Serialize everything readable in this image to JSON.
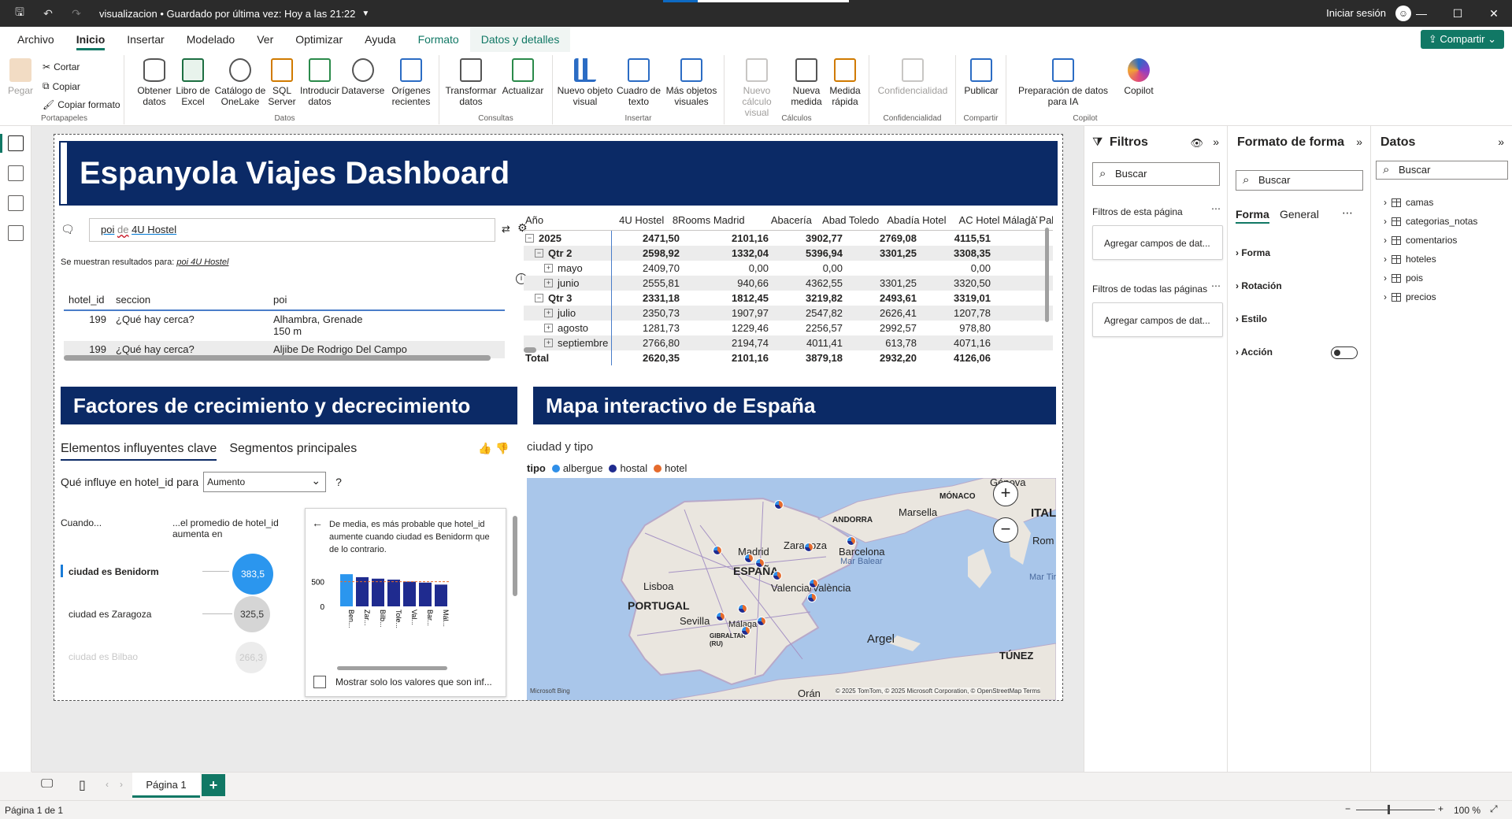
{
  "titlebar": {
    "doc_title": "visualizacion • Guardado por última vez: Hoy a las 21:22",
    "signin": "Iniciar sesión"
  },
  "tabs": [
    "Archivo",
    "Inicio",
    "Insertar",
    "Modelado",
    "Ver",
    "Optimizar",
    "Ayuda",
    "Formato",
    "Datos y detalles"
  ],
  "share_label": "Compartir",
  "ribbon": {
    "clipboard": {
      "paste": "Pegar",
      "cut": "Cortar",
      "copy": "Copiar",
      "format_painter": "Copiar formato",
      "group": "Portapapeles"
    },
    "data": {
      "get_data": "Obtener datos",
      "excel": "Libro de Excel",
      "onelake": "Catálogo de OneLake",
      "sql": "SQL Server",
      "enter": "Introducir datos",
      "dataverse": "Dataverse",
      "recent": "Orígenes recientes",
      "group": "Datos"
    },
    "queries": {
      "transform": "Transformar datos",
      "refresh": "Actualizar",
      "group": "Consultas"
    },
    "insert": {
      "new_visual": "Nuevo objeto visual",
      "textbox": "Cuadro de texto",
      "more_visuals": "Más objetos visuales",
      "group": "Insertar"
    },
    "calc": {
      "new_calc": "Nuevo cálculo visual",
      "new_measure": "Nueva medida",
      "quick_measure": "Medida rápida",
      "group": "Cálculos"
    },
    "conf": {
      "sensitivity": "Confidencialidad",
      "group": "Confidencialidad"
    },
    "share": {
      "publish": "Publicar",
      "group": "Compartir"
    },
    "copilot": {
      "prep": "Preparación de datos para IA",
      "copilot": "Copilot",
      "group": "Copilot"
    }
  },
  "dashboard": {
    "title": "Espanyola Viajes Dashboard",
    "qna": {
      "query_a": "poi",
      "query_b": "de",
      "query_c": "4U Hostel",
      "result_prefix": "Se muestran resultados para:",
      "result_value": "poi 4U Hostel",
      "columns": [
        "hotel_id",
        "seccion",
        "poi"
      ],
      "rows": [
        {
          "id": "199",
          "seccion": "¿Qué hay cerca?",
          "poi": "Alhambra, Grenade",
          "poi2": "150 m"
        },
        {
          "id": "199",
          "seccion": "¿Qué hay cerca?",
          "poi": "Aljibe De Rodrigo Del Campo",
          "poi2": ""
        }
      ]
    },
    "matrix": {
      "header": [
        "Año",
        "4U Hostel",
        "8Rooms Madrid",
        "Abacería",
        "Abad Toledo",
        "Abadía Hotel",
        "AC Hotel Málaga Pala"
      ],
      "rows": [
        {
          "label": "2025",
          "level": 0,
          "bold": true,
          "vals": [
            "2471,50",
            "2101,16",
            "3902,77",
            "2769,08",
            "4115,51"
          ]
        },
        {
          "label": "Qtr 2",
          "level": 1,
          "bold": true,
          "vals": [
            "2598,92",
            "1332,04",
            "5396,94",
            "3301,25",
            "3308,35"
          ]
        },
        {
          "label": "mayo",
          "level": 2,
          "bold": false,
          "vals": [
            "2409,70",
            "0,00",
            "0,00",
            "",
            "0,00"
          ]
        },
        {
          "label": "junio",
          "level": 2,
          "bold": false,
          "vals": [
            "2555,81",
            "940,66",
            "4362,55",
            "3301,25",
            "3320,50"
          ]
        },
        {
          "label": "Qtr 3",
          "level": 1,
          "bold": true,
          "vals": [
            "2331,18",
            "1812,45",
            "3219,82",
            "2493,61",
            "3319,01"
          ]
        },
        {
          "label": "julio",
          "level": 2,
          "bold": false,
          "vals": [
            "2350,73",
            "1907,97",
            "2547,82",
            "2626,41",
            "1207,78"
          ]
        },
        {
          "label": "agosto",
          "level": 2,
          "bold": false,
          "vals": [
            "1281,73",
            "1229,46",
            "2256,57",
            "2992,57",
            "978,80"
          ]
        },
        {
          "label": "septiembre",
          "level": 2,
          "bold": false,
          "vals": [
            "2766,80",
            "2194,74",
            "4011,41",
            "613,78",
            "4071,16"
          ]
        },
        {
          "label": "Total",
          "level": 0,
          "bold": true,
          "vals": [
            "2620,35",
            "2101,16",
            "3879,18",
            "2932,20",
            "4126,06"
          ]
        }
      ]
    },
    "growth_title": "Factores de crecimiento y decrecimiento",
    "map_title": "Mapa interactivo de España",
    "ki": {
      "tab1": "Elementos influyentes clave",
      "tab2": "Segmentos principales",
      "question": "Qué influye en hotel_id para",
      "select": "Aumento",
      "help": "?",
      "col_when": "Cuando...",
      "col_avg": "...el promedio de hotel_id aumenta en",
      "items": [
        {
          "label": "ciudad es Benidorm",
          "value": "383,5"
        },
        {
          "label": "ciudad es Zaragoza",
          "value": "325,5"
        },
        {
          "label": "ciudad es Bilbao",
          "value": "266,3"
        }
      ],
      "card_text": "De media, es más probable que hotel_id aumente cuando ciudad es Benidorm que de lo contrario.",
      "card_checkbox": "Mostrar solo los valores que son inf...",
      "chart_ticks": [
        "500",
        "0"
      ]
    },
    "map": {
      "subtitle": "ciudad y tipo",
      "legend_title": "tipo",
      "legend": [
        {
          "name": "albergue",
          "color": "#2f8fe8"
        },
        {
          "name": "hostal",
          "color": "#1f2b8f"
        },
        {
          "name": "hotel",
          "color": "#e56b2d"
        }
      ],
      "labels": {
        "madrid": "Madrid",
        "espana": "ESPAÑA",
        "zaragoza": "Zaragoza",
        "barcelona": "Barcelona",
        "marsella": "Marsella",
        "andorra": "ANDORRA",
        "monaco": "MÓNACO",
        "genova": "Génova",
        "lisboa": "Lisboa",
        "portugal": "PORTUGAL",
        "valencia": "Valencia/València",
        "sevilla": "Sevilla",
        "malaga": "Málaga",
        "gibraltar": "GIBRALTAR (RU)",
        "argel": "Argel",
        "oran": "Orán",
        "italia": "ITALI",
        "roma": "Rom",
        "balear": "Mar Balear",
        "tirreno": "Mar Tirr",
        "tunez": "TÚNEZ"
      },
      "attribution": "© 2025 TomTom, © 2025 Microsoft Corporation, © OpenStreetMap Terms",
      "bing": "Microsoft Bing"
    }
  },
  "chart_data": {
    "type": "bar",
    "categories": [
      "Ben...",
      "Zar...",
      "Bilb...",
      "Tole...",
      "Val...",
      "Bar...",
      "Mál..."
    ],
    "values": [
      650,
      590,
      560,
      540,
      500,
      480,
      440
    ],
    "ylim": [
      0,
      700
    ],
    "ytick_labels": [
      "500",
      "0"
    ]
  },
  "filters": {
    "title": "Filtros",
    "search": "Buscar",
    "page_filters": "Filtros de esta página",
    "all_pages": "Filtros de todas las páginas",
    "add_fields": "Agregar campos de dat..."
  },
  "format": {
    "title": "Formato de forma",
    "search": "Buscar",
    "tab_forma": "Forma",
    "tab_general": "General",
    "items": [
      "Forma",
      "Rotación",
      "Estilo",
      "Acción"
    ]
  },
  "data_pane": {
    "title": "Datos",
    "search": "Buscar",
    "tables": [
      "camas",
      "categorias_notas",
      "comentarios",
      "hoteles",
      "pois",
      "precios"
    ]
  },
  "page_tab": "Página 1",
  "status": {
    "pages": "Página 1 de 1",
    "zoom": "100 %"
  }
}
